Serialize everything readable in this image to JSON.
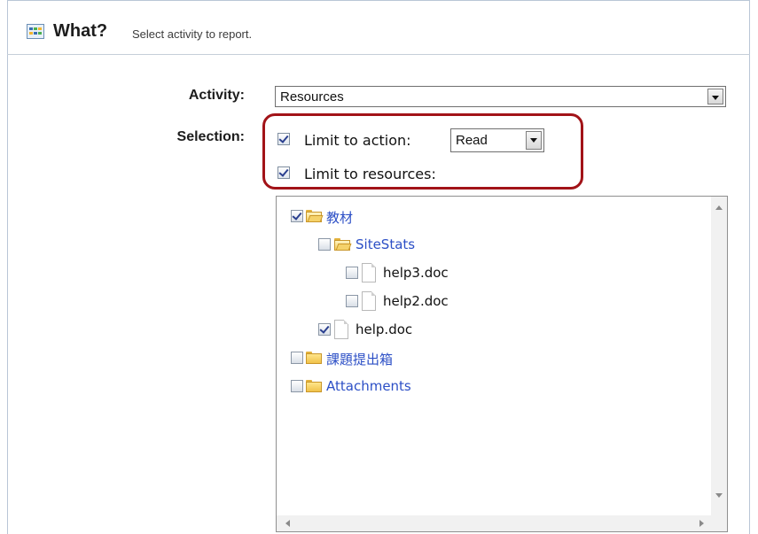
{
  "header": {
    "title": "What?",
    "subtitle": "Select activity to report.",
    "icon": "table-icon"
  },
  "form": {
    "activity_label": "Activity:",
    "activity_value": "Resources",
    "selection_label": "Selection:",
    "limit_action_label": "Limit to action:",
    "limit_action_checked": true,
    "action_value": "Read",
    "limit_resources_label": "Limit to resources:",
    "limit_resources_checked": true
  },
  "tree": [
    {
      "label": "教材",
      "type": "folder-open",
      "checked": true
    },
    {
      "label": "SiteStats",
      "type": "folder-open",
      "checked": false
    },
    {
      "label": "help3.doc",
      "type": "file",
      "checked": false
    },
    {
      "label": "help2.doc",
      "type": "file",
      "checked": false
    },
    {
      "label": "help.doc",
      "type": "file",
      "checked": true
    },
    {
      "label": "課題提出箱",
      "type": "folder",
      "checked": false
    },
    {
      "label": "Attachments",
      "type": "folder",
      "checked": false
    }
  ],
  "colors": {
    "highlight": "#a21318",
    "link": "#2c4fc6",
    "border": "#b9c6d6"
  }
}
